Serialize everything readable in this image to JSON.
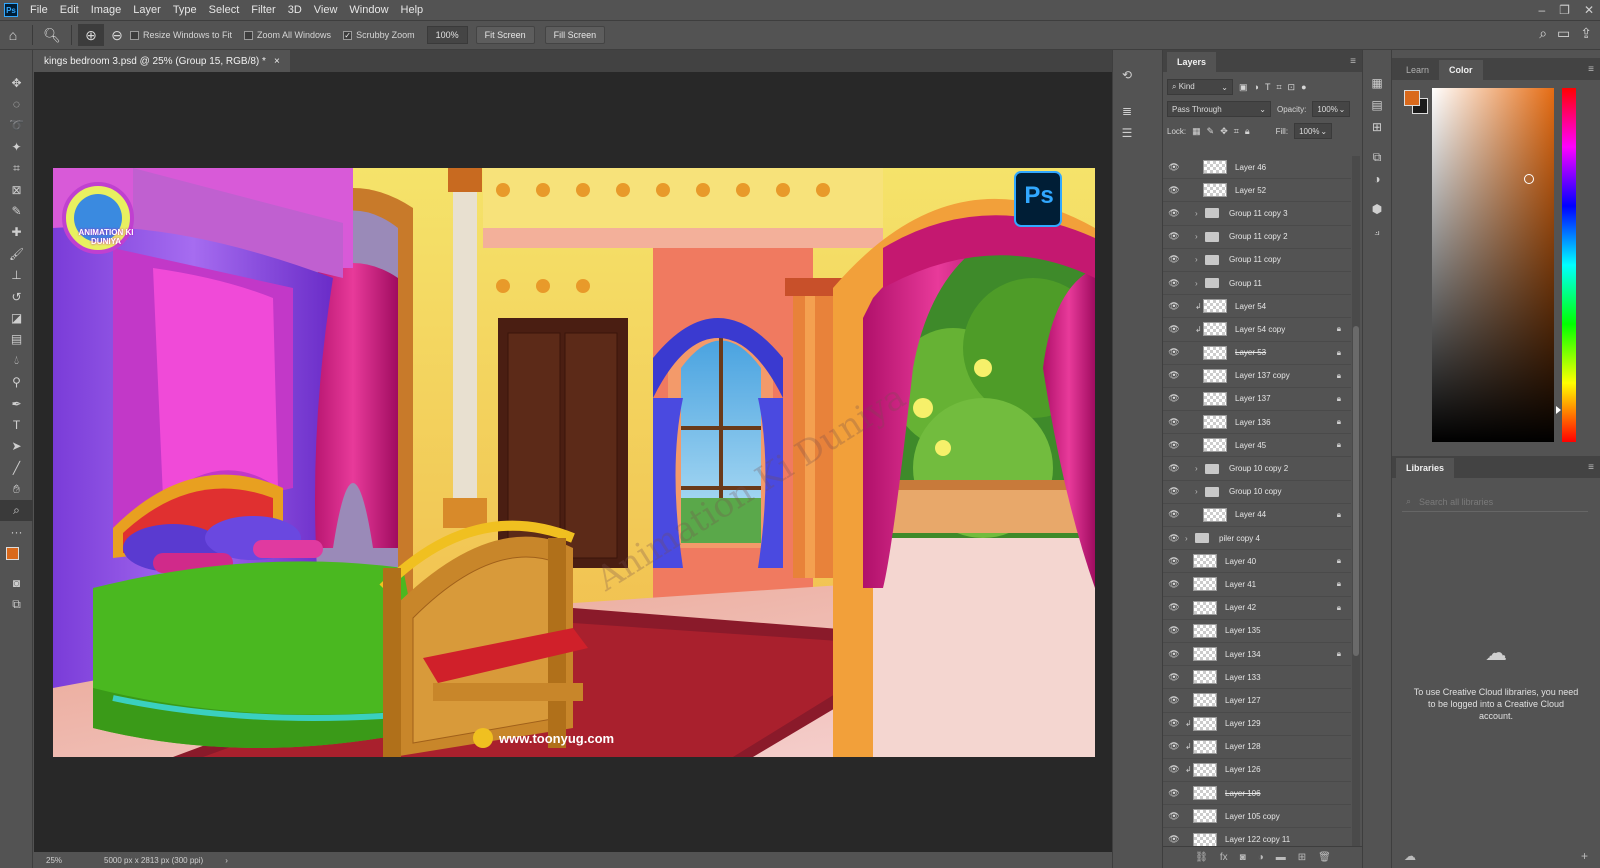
{
  "app": {
    "logo_text": "Ps",
    "menu": [
      "File",
      "Edit",
      "Image",
      "Layer",
      "Type",
      "Select",
      "Filter",
      "3D",
      "View",
      "Window",
      "Help"
    ],
    "window_controls": [
      "–",
      "❐",
      "✕"
    ]
  },
  "options_bar": {
    "checks": [
      {
        "label": "Resize Windows to Fit",
        "checked": false
      },
      {
        "label": "Zoom All Windows",
        "checked": false
      },
      {
        "label": "Scrubby Zoom",
        "checked": true
      }
    ],
    "zoom_value": "100%",
    "fit_screen": "Fit Screen",
    "fill_screen": "Fill Screen"
  },
  "document": {
    "tab_title": "kings bedroom 3.psd @ 25% (Group 15, RGB/8) *",
    "close": "×",
    "status_zoom": "25%",
    "status_info": "5000 px x 2813 px (300 ppi)",
    "status_arrow": "›",
    "watermark_url": "www.toonyug.com",
    "watermark_text": "Animation Ki Duniya",
    "logo_text": "ANIMATION KI DUNIYA",
    "ps_badge": "Ps"
  },
  "layers_panel": {
    "tab_label": "Layers",
    "filter_kind": "Kind",
    "blend_mode": "Pass Through",
    "opacity_label": "Opacity:",
    "opacity_value": "100%",
    "lock_label": "Lock:",
    "fill_label": "Fill:",
    "fill_value": "100%",
    "layers": [
      {
        "name": "Layer 46",
        "type": "layer",
        "indent": 1,
        "locked": false,
        "clipped": false
      },
      {
        "name": "Layer 52",
        "type": "layer",
        "indent": 1,
        "locked": false,
        "clipped": false
      },
      {
        "name": "Group 11 copy 3",
        "type": "group",
        "indent": 1,
        "locked": false,
        "clipped": false
      },
      {
        "name": "Group 11 copy 2",
        "type": "group",
        "indent": 1,
        "locked": false,
        "clipped": false
      },
      {
        "name": "Group 11 copy",
        "type": "group",
        "indent": 1,
        "locked": false,
        "clipped": false
      },
      {
        "name": "Group 11",
        "type": "group",
        "indent": 1,
        "locked": false,
        "clipped": false
      },
      {
        "name": "Layer 54",
        "type": "layer",
        "indent": 1,
        "locked": false,
        "clipped": true
      },
      {
        "name": "Layer 54 copy",
        "type": "layer",
        "indent": 1,
        "locked": true,
        "clipped": true
      },
      {
        "name": "Layer 53",
        "type": "layer",
        "indent": 1,
        "locked": true,
        "clipped": false,
        "strike": true
      },
      {
        "name": "Layer 137 copy",
        "type": "layer",
        "indent": 1,
        "locked": true,
        "clipped": false
      },
      {
        "name": "Layer 137",
        "type": "layer",
        "indent": 1,
        "locked": true,
        "clipped": false
      },
      {
        "name": "Layer 136",
        "type": "layer",
        "indent": 1,
        "locked": true,
        "clipped": false
      },
      {
        "name": "Layer 45",
        "type": "layer",
        "indent": 1,
        "locked": true,
        "clipped": false
      },
      {
        "name": "Group 10 copy 2",
        "type": "group",
        "indent": 1,
        "locked": false,
        "clipped": false
      },
      {
        "name": "Group 10 copy",
        "type": "group",
        "indent": 1,
        "locked": false,
        "clipped": false
      },
      {
        "name": "Layer 44",
        "type": "layer",
        "indent": 1,
        "locked": true,
        "clipped": false
      },
      {
        "name": "piler copy 4",
        "type": "group",
        "indent": 0,
        "locked": false,
        "clipped": false
      },
      {
        "name": "Layer 40",
        "type": "layer",
        "indent": 0,
        "locked": true,
        "clipped": false
      },
      {
        "name": "Layer 41",
        "type": "layer",
        "indent": 0,
        "locked": true,
        "clipped": false
      },
      {
        "name": "Layer 42",
        "type": "layer",
        "indent": 0,
        "locked": true,
        "clipped": false
      },
      {
        "name": "Layer 135",
        "type": "layer",
        "indent": 0,
        "locked": false,
        "clipped": false
      },
      {
        "name": "Layer 134",
        "type": "layer",
        "indent": 0,
        "locked": true,
        "clipped": false
      },
      {
        "name": "Layer 133",
        "type": "layer",
        "indent": 0,
        "locked": false,
        "clipped": false
      },
      {
        "name": "Layer 127",
        "type": "layer",
        "indent": 0,
        "locked": false,
        "clipped": false
      },
      {
        "name": "Layer 129",
        "type": "layer",
        "indent": 0,
        "locked": false,
        "clipped": true
      },
      {
        "name": "Layer 128",
        "type": "layer",
        "indent": 0,
        "locked": false,
        "clipped": true
      },
      {
        "name": "Layer 126",
        "type": "layer",
        "indent": 0,
        "locked": false,
        "clipped": true
      },
      {
        "name": "Layer 106",
        "type": "layer",
        "indent": 0,
        "locked": false,
        "clipped": false,
        "strike": true
      },
      {
        "name": "Layer 105 copy",
        "type": "layer",
        "indent": 0,
        "locked": false,
        "clipped": false
      },
      {
        "name": "Layer 122 copy 11",
        "type": "layer",
        "indent": 0,
        "locked": false,
        "clipped": false
      }
    ]
  },
  "color_panel": {
    "tabs": [
      "Learn",
      "Color"
    ],
    "foreground": "#d9691c",
    "background": "#1a1a1a"
  },
  "libraries_panel": {
    "tab_label": "Libraries",
    "search_placeholder": "Search all libraries",
    "message": "To use Creative Cloud libraries, you need to be logged into a Creative Cloud account."
  }
}
